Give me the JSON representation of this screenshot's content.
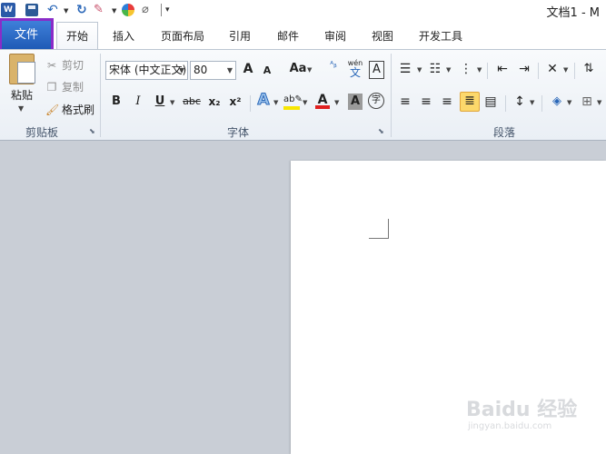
{
  "window": {
    "title": "文档1 - M"
  },
  "tabs": {
    "file": "文件",
    "home": "开始",
    "insert": "插入",
    "layout": "页面布局",
    "references": "引用",
    "mailings": "邮件",
    "review": "审阅",
    "view": "视图",
    "developer": "开发工具"
  },
  "clipboard": {
    "paste": "粘贴",
    "cut": "剪切",
    "copy": "复制",
    "format_painter": "格式刷",
    "label": "剪贴板"
  },
  "font": {
    "name": "宋体 (中文正文)",
    "size": "80",
    "label": "字体",
    "grow": "A",
    "shrink": "A",
    "change_case": "Aa",
    "bold": "B",
    "italic": "I",
    "underline": "U",
    "strike": "abc",
    "subscript": "x₂",
    "superscript": "x²",
    "phonetic_top": "wén",
    "phonetic_bottom": "文",
    "border_char": "A",
    "effects": "A",
    "font_color": "A",
    "shading": "A",
    "enclose": "字"
  },
  "paragraph": {
    "label": "段落"
  },
  "colors": {
    "file_tab": "#2b62c0",
    "highlight_box": "#8a2cc8",
    "font_color_bar": "#e02020",
    "highlight_bar": "#f7e600"
  },
  "watermark": {
    "brand": "Baidu 经验",
    "url": "jingyan.baidu.com"
  }
}
